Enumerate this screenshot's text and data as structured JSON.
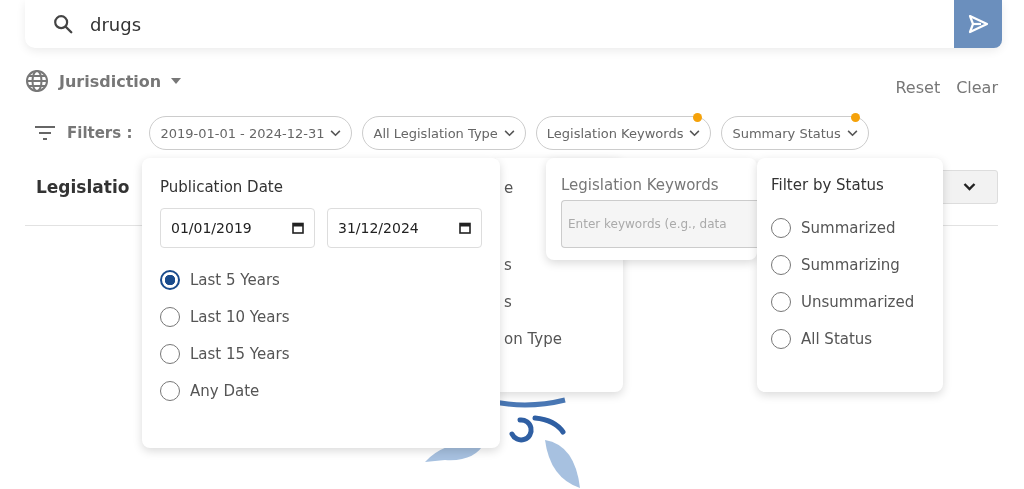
{
  "search": {
    "value": "drugs"
  },
  "jurisdiction": {
    "label": "Jurisdiction"
  },
  "actions": [
    "Reset",
    "Clear"
  ],
  "filters_label": "Filters :",
  "chips": [
    {
      "label": "2019-01-01 - 2024-12-31",
      "badge": false
    },
    {
      "label": "All Legislation Type",
      "badge": false
    },
    {
      "label": "Legislation Keywords",
      "badge": true
    },
    {
      "label": "Summary Status",
      "badge": true
    }
  ],
  "heading": "Legislatio",
  "date_panel": {
    "title": "Publication Date",
    "from": "01/01/2019",
    "to": "31/12/2024",
    "options": [
      {
        "label": "Last 5 Years",
        "selected": true
      },
      {
        "label": "Last 10 Years",
        "selected": false
      },
      {
        "label": "Last 15 Years",
        "selected": false
      },
      {
        "label": "Any Date",
        "selected": false
      }
    ]
  },
  "type_panel": {
    "items": [
      "e",
      "s",
      "s",
      "on Type"
    ]
  },
  "keywords_panel": {
    "title": "Legislation Keywords",
    "placeholder": "Enter keywords (e.g., data"
  },
  "status_panel": {
    "title": "Filter by Status",
    "options": [
      {
        "label": "Summarized",
        "selected": false
      },
      {
        "label": "Summarizing",
        "selected": false
      },
      {
        "label": "Unsummarized",
        "selected": false
      },
      {
        "label": "All Status",
        "selected": false
      }
    ]
  }
}
